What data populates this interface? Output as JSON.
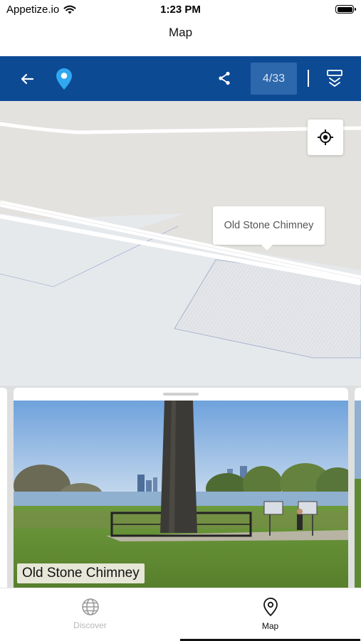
{
  "status_bar": {
    "carrier": "Appetize.io",
    "time": "1:23 PM"
  },
  "nav": {
    "title": "Map"
  },
  "toolbar": {
    "pager": "4/33",
    "colors": {
      "background": "#0d4a94",
      "pin": "#2fa8ef"
    }
  },
  "map": {
    "callout": "Old Stone Chimney"
  },
  "card": {
    "title": "Old Stone Chimney"
  },
  "tabs": [
    {
      "label": "Discover",
      "icon": "globe-icon",
      "active": false
    },
    {
      "label": "Map",
      "icon": "map-pin-icon",
      "active": true
    }
  ]
}
